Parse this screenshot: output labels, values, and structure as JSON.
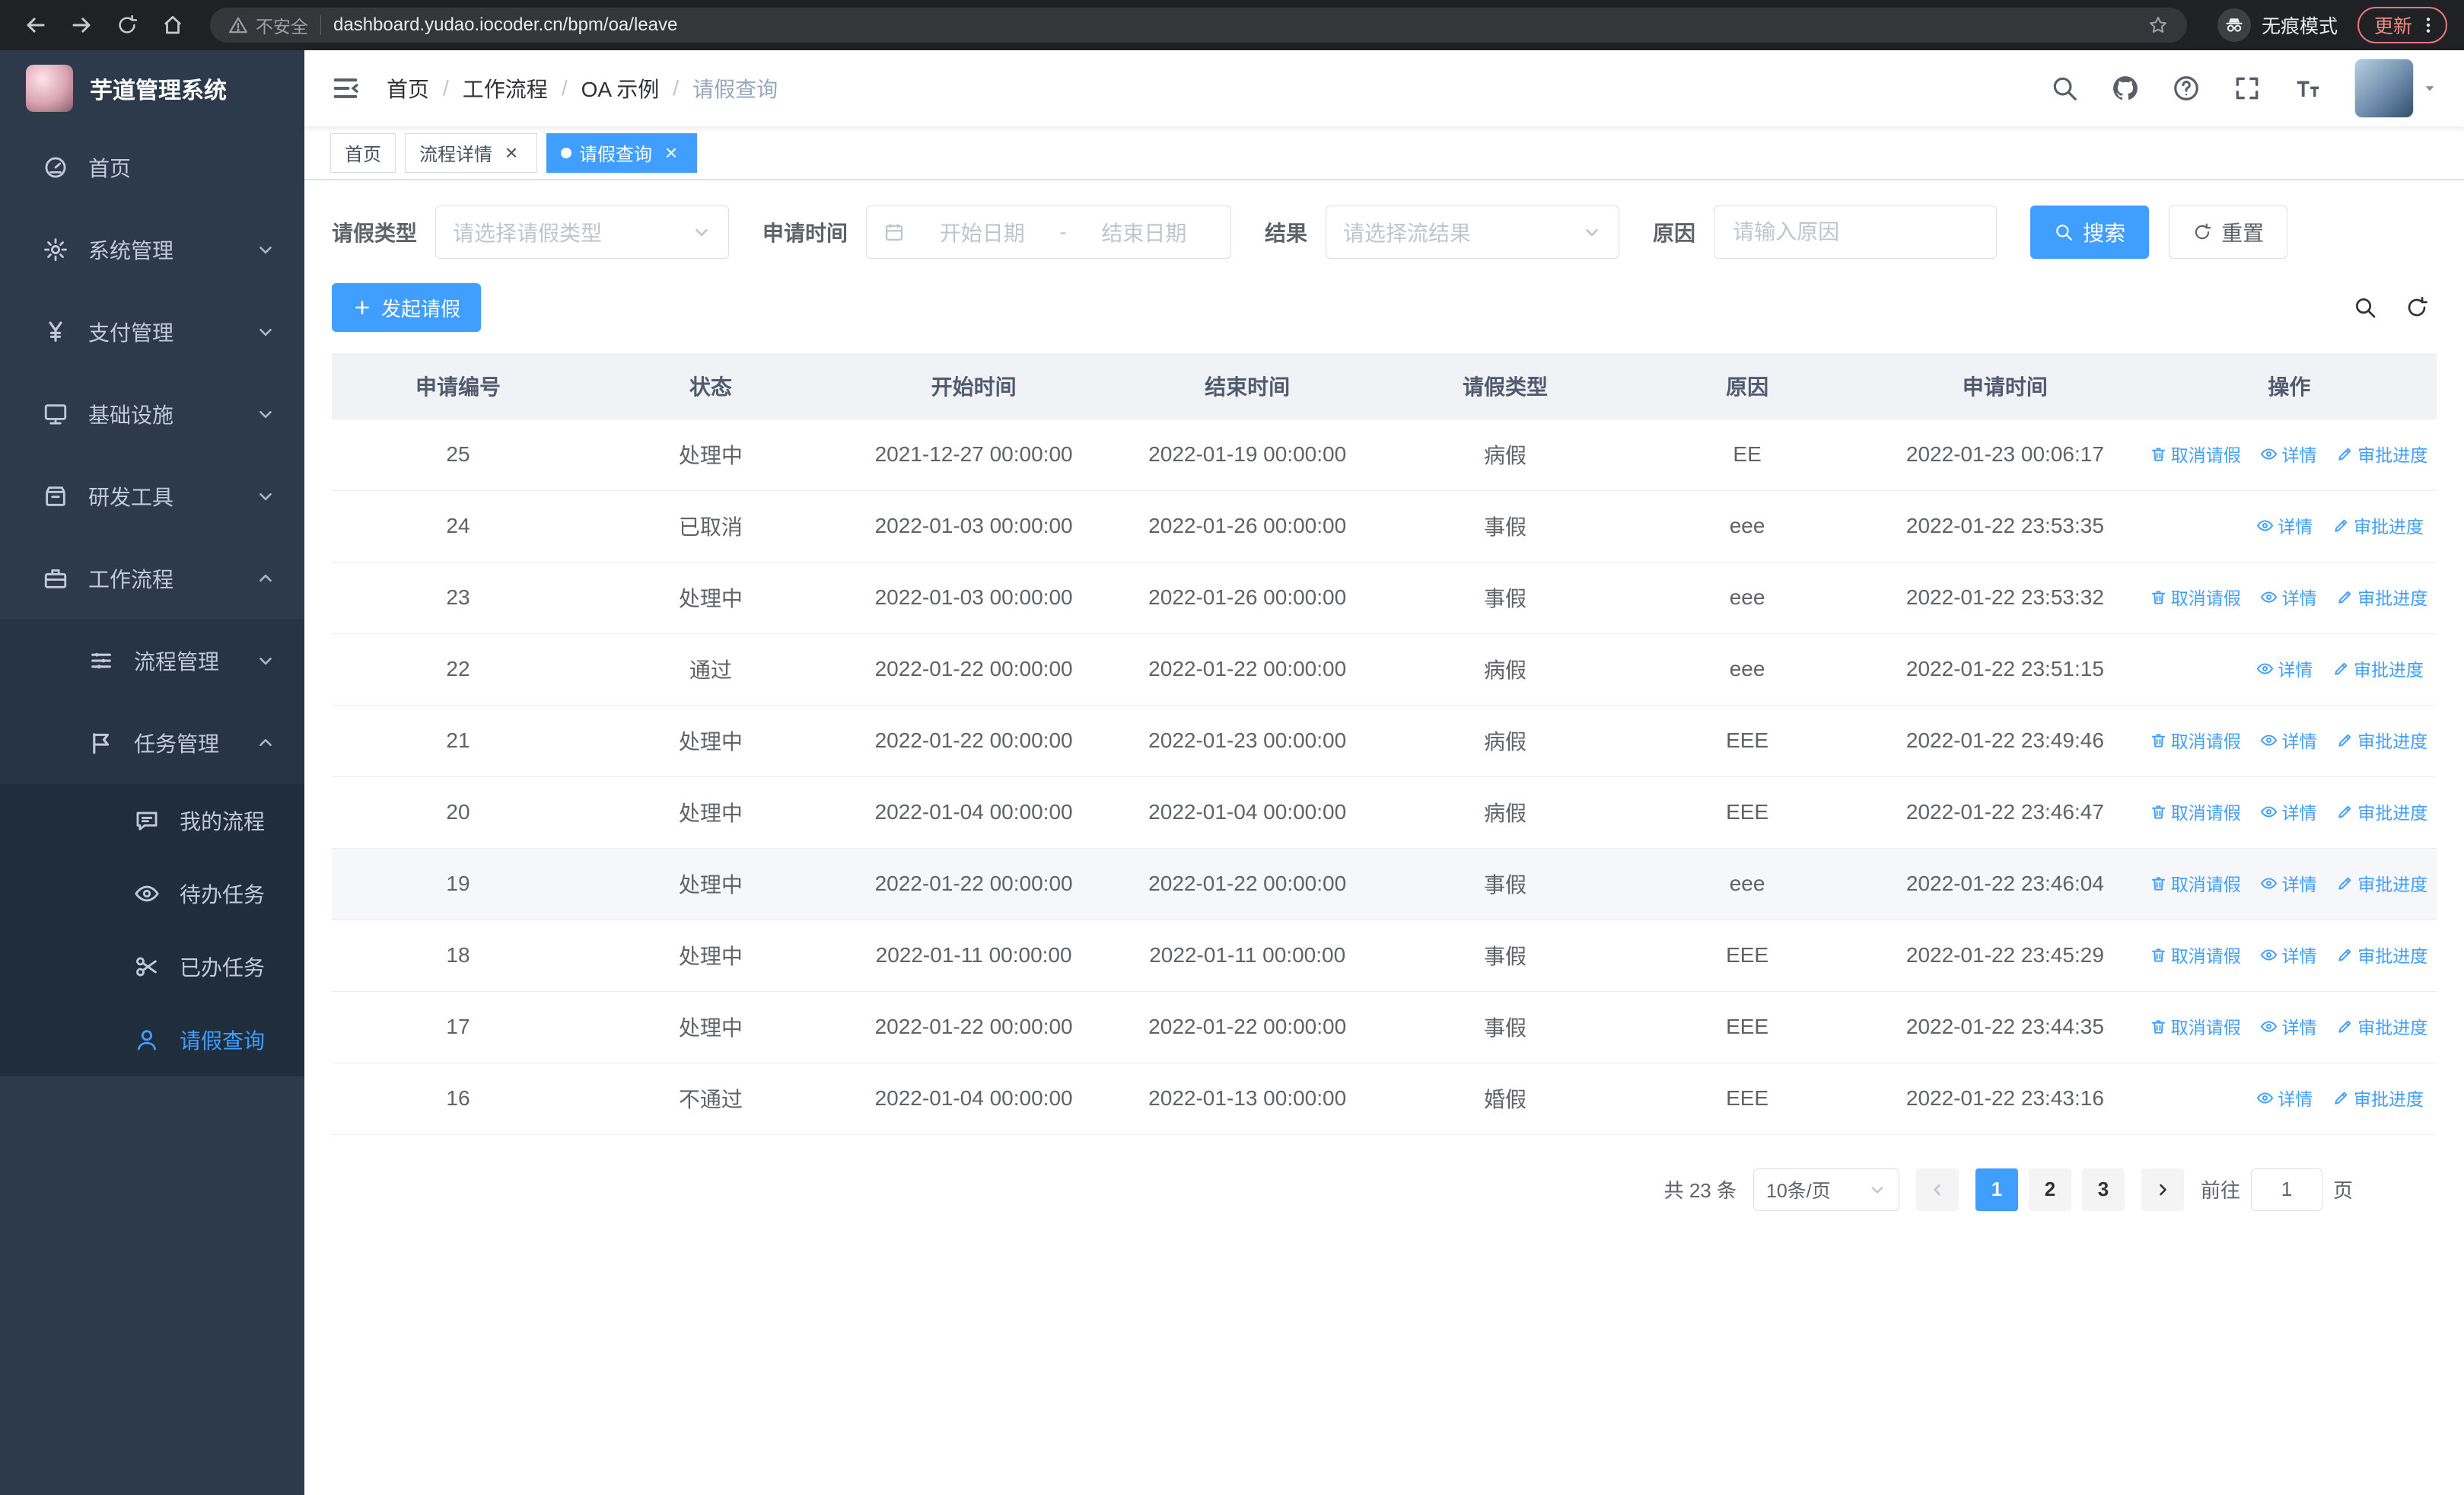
{
  "colors": {
    "primary": "#409eff",
    "sidebar_bg": "#2d3a4b",
    "active_tab_bg": "#409eff"
  },
  "browser": {
    "security_label": "不安全",
    "url": "dashboard.yudao.iocoder.cn/bpm/oa/leave",
    "incognito_label": "无痕模式",
    "update_label": "更新"
  },
  "sidebar": {
    "logo_title": "芋道管理系统",
    "items": [
      {
        "label": "首页",
        "icon": "home",
        "level": 1
      },
      {
        "label": "系统管理",
        "icon": "gear",
        "level": 1,
        "chevron": "down"
      },
      {
        "label": "支付管理",
        "icon": "yen",
        "level": 1,
        "chevron": "down"
      },
      {
        "label": "基础设施",
        "icon": "infra",
        "level": 1,
        "chevron": "down"
      },
      {
        "label": "研发工具",
        "icon": "tools",
        "level": 1,
        "chevron": "down"
      },
      {
        "label": "工作流程",
        "icon": "workflow",
        "level": 1,
        "chevron": "up"
      },
      {
        "label": "流程管理",
        "icon": "process",
        "level": 2,
        "chevron": "down"
      },
      {
        "label": "任务管理",
        "icon": "task",
        "level": 2,
        "chevron": "up"
      },
      {
        "label": "我的流程",
        "icon": "chat",
        "level": 3
      },
      {
        "label": "待办任务",
        "icon": "eye",
        "level": 3
      },
      {
        "label": "已办任务",
        "icon": "scissors",
        "level": 3
      },
      {
        "label": "请假查询",
        "icon": "user",
        "level": 3,
        "active": true
      }
    ]
  },
  "header": {
    "breadcrumb": [
      "首页",
      "工作流程",
      "OA 示例",
      "请假查询"
    ]
  },
  "tabs": [
    {
      "label": "首页",
      "closable": false,
      "active": false
    },
    {
      "label": "流程详情",
      "closable": true,
      "active": false
    },
    {
      "label": "请假查询",
      "closable": true,
      "active": true
    }
  ],
  "filters": {
    "leave_type_label": "请假类型",
    "leave_type_placeholder": "请选择请假类型",
    "apply_time_label": "申请时间",
    "start_placeholder": "开始日期",
    "range_separator": "-",
    "end_placeholder": "结束日期",
    "result_label": "结果",
    "result_placeholder": "请选择流结果",
    "reason_label": "原因",
    "reason_placeholder": "请输入原因",
    "search_label": "搜索",
    "reset_label": "重置"
  },
  "toolbar": {
    "create_label": "发起请假"
  },
  "table": {
    "columns": [
      "申请编号",
      "状态",
      "开始时间",
      "结束时间",
      "请假类型",
      "原因",
      "申请时间",
      "操作"
    ],
    "action_labels": {
      "cancel": "取消请假",
      "detail": "详情",
      "progress": "审批进度"
    },
    "rows": [
      {
        "id": "25",
        "status": "处理中",
        "start_time": "2021-12-27 00:00:00",
        "end_time": "2022-01-19 00:00:00",
        "leave_type": "病假",
        "reason": "EE",
        "apply_time": "2022-01-23 00:06:17",
        "can_cancel": true,
        "highlighted": false
      },
      {
        "id": "24",
        "status": "已取消",
        "start_time": "2022-01-03 00:00:00",
        "end_time": "2022-01-26 00:00:00",
        "leave_type": "事假",
        "reason": "eee",
        "apply_time": "2022-01-22 23:53:35",
        "can_cancel": false,
        "highlighted": false
      },
      {
        "id": "23",
        "status": "处理中",
        "start_time": "2022-01-03 00:00:00",
        "end_time": "2022-01-26 00:00:00",
        "leave_type": "事假",
        "reason": "eee",
        "apply_time": "2022-01-22 23:53:32",
        "can_cancel": true,
        "highlighted": false
      },
      {
        "id": "22",
        "status": "通过",
        "start_time": "2022-01-22 00:00:00",
        "end_time": "2022-01-22 00:00:00",
        "leave_type": "病假",
        "reason": "eee",
        "apply_time": "2022-01-22 23:51:15",
        "can_cancel": false,
        "highlighted": false
      },
      {
        "id": "21",
        "status": "处理中",
        "start_time": "2022-01-22 00:00:00",
        "end_time": "2022-01-23 00:00:00",
        "leave_type": "病假",
        "reason": "EEE",
        "apply_time": "2022-01-22 23:49:46",
        "can_cancel": true,
        "highlighted": false
      },
      {
        "id": "20",
        "status": "处理中",
        "start_time": "2022-01-04 00:00:00",
        "end_time": "2022-01-04 00:00:00",
        "leave_type": "病假",
        "reason": "EEE",
        "apply_time": "2022-01-22 23:46:47",
        "can_cancel": true,
        "highlighted": false
      },
      {
        "id": "19",
        "status": "处理中",
        "start_time": "2022-01-22 00:00:00",
        "end_time": "2022-01-22 00:00:00",
        "leave_type": "事假",
        "reason": "eee",
        "apply_time": "2022-01-22 23:46:04",
        "can_cancel": true,
        "highlighted": true
      },
      {
        "id": "18",
        "status": "处理中",
        "start_time": "2022-01-11 00:00:00",
        "end_time": "2022-01-11 00:00:00",
        "leave_type": "事假",
        "reason": "EEE",
        "apply_time": "2022-01-22 23:45:29",
        "can_cancel": true,
        "highlighted": false
      },
      {
        "id": "17",
        "status": "处理中",
        "start_time": "2022-01-22 00:00:00",
        "end_time": "2022-01-22 00:00:00",
        "leave_type": "事假",
        "reason": "EEE",
        "apply_time": "2022-01-22 23:44:35",
        "can_cancel": true,
        "highlighted": false
      },
      {
        "id": "16",
        "status": "不通过",
        "start_time": "2022-01-04 00:00:00",
        "end_time": "2022-01-13 00:00:00",
        "leave_type": "婚假",
        "reason": "EEE",
        "apply_time": "2022-01-22 23:43:16",
        "can_cancel": false,
        "highlighted": false
      }
    ]
  },
  "pagination": {
    "total_label": "共 23 条",
    "page_size_label": "10条/页",
    "pages": [
      "1",
      "2",
      "3"
    ],
    "active_page": "1",
    "goto_label": "前往",
    "goto_value": "1",
    "goto_unit": "页"
  }
}
